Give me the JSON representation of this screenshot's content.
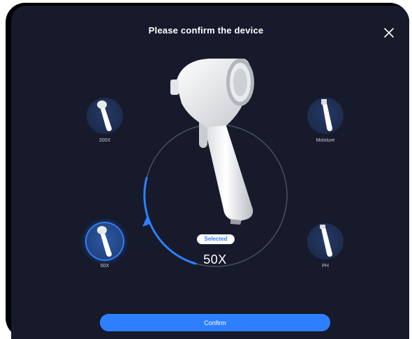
{
  "dialog": {
    "title": "Please confirm the device",
    "close_icon": "close-icon"
  },
  "devices": [
    {
      "label": "200X",
      "icon": "scope-200x-icon",
      "selected": false
    },
    {
      "label": "Moisture",
      "icon": "moisture-probe-icon",
      "selected": false
    },
    {
      "label": "50X",
      "icon": "scope-50x-icon",
      "selected": true
    },
    {
      "label": "PH",
      "icon": "ph-probe-icon",
      "selected": false
    }
  ],
  "selection": {
    "badge": "Selected",
    "value": "50X"
  },
  "footer": {
    "confirm_label": "Confirm"
  },
  "colors": {
    "background": "#161a2a",
    "accent": "#2d7fff",
    "disc": "#1d2b4d",
    "text": "#ffffff"
  }
}
